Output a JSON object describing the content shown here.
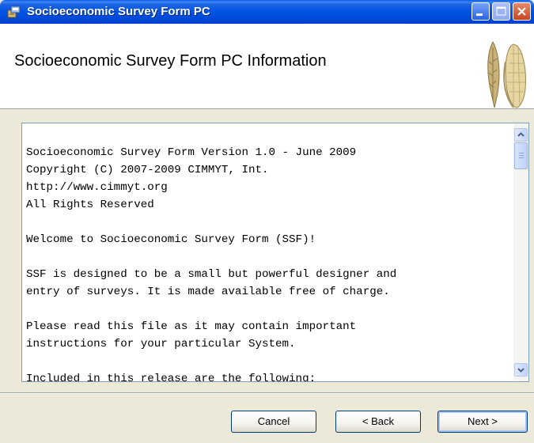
{
  "window": {
    "title": "Socioeconomic Survey Form PC",
    "controls": [
      "minimize",
      "maximize",
      "close"
    ]
  },
  "header": {
    "title": "Socioeconomic Survey Form PC Information",
    "logo_icon": "wheat-and-corn-logo"
  },
  "readme": {
    "lines": [
      "Socioeconomic Survey Form Version 1.0 - June 2009",
      "Copyright (C) 2007-2009 CIMMYT, Int.",
      "http://www.cimmyt.org",
      "All Rights Reserved",
      "",
      "Welcome to Socioeconomic Survey Form (SSF)!",
      "",
      "SSF is designed to be a small but powerful designer and",
      "entry of surveys. It is made available free of charge.",
      "",
      "Please read this file as it may contain important",
      "instructions for your particular System.",
      "",
      "Included in this release are the following:"
    ]
  },
  "buttons": {
    "cancel": "Cancel",
    "back": "< Back",
    "next": "Next >"
  },
  "colors": {
    "titlebar": "#0054e3",
    "dialog_bg": "#ece9d8",
    "textbox_border": "#7f9db9"
  }
}
